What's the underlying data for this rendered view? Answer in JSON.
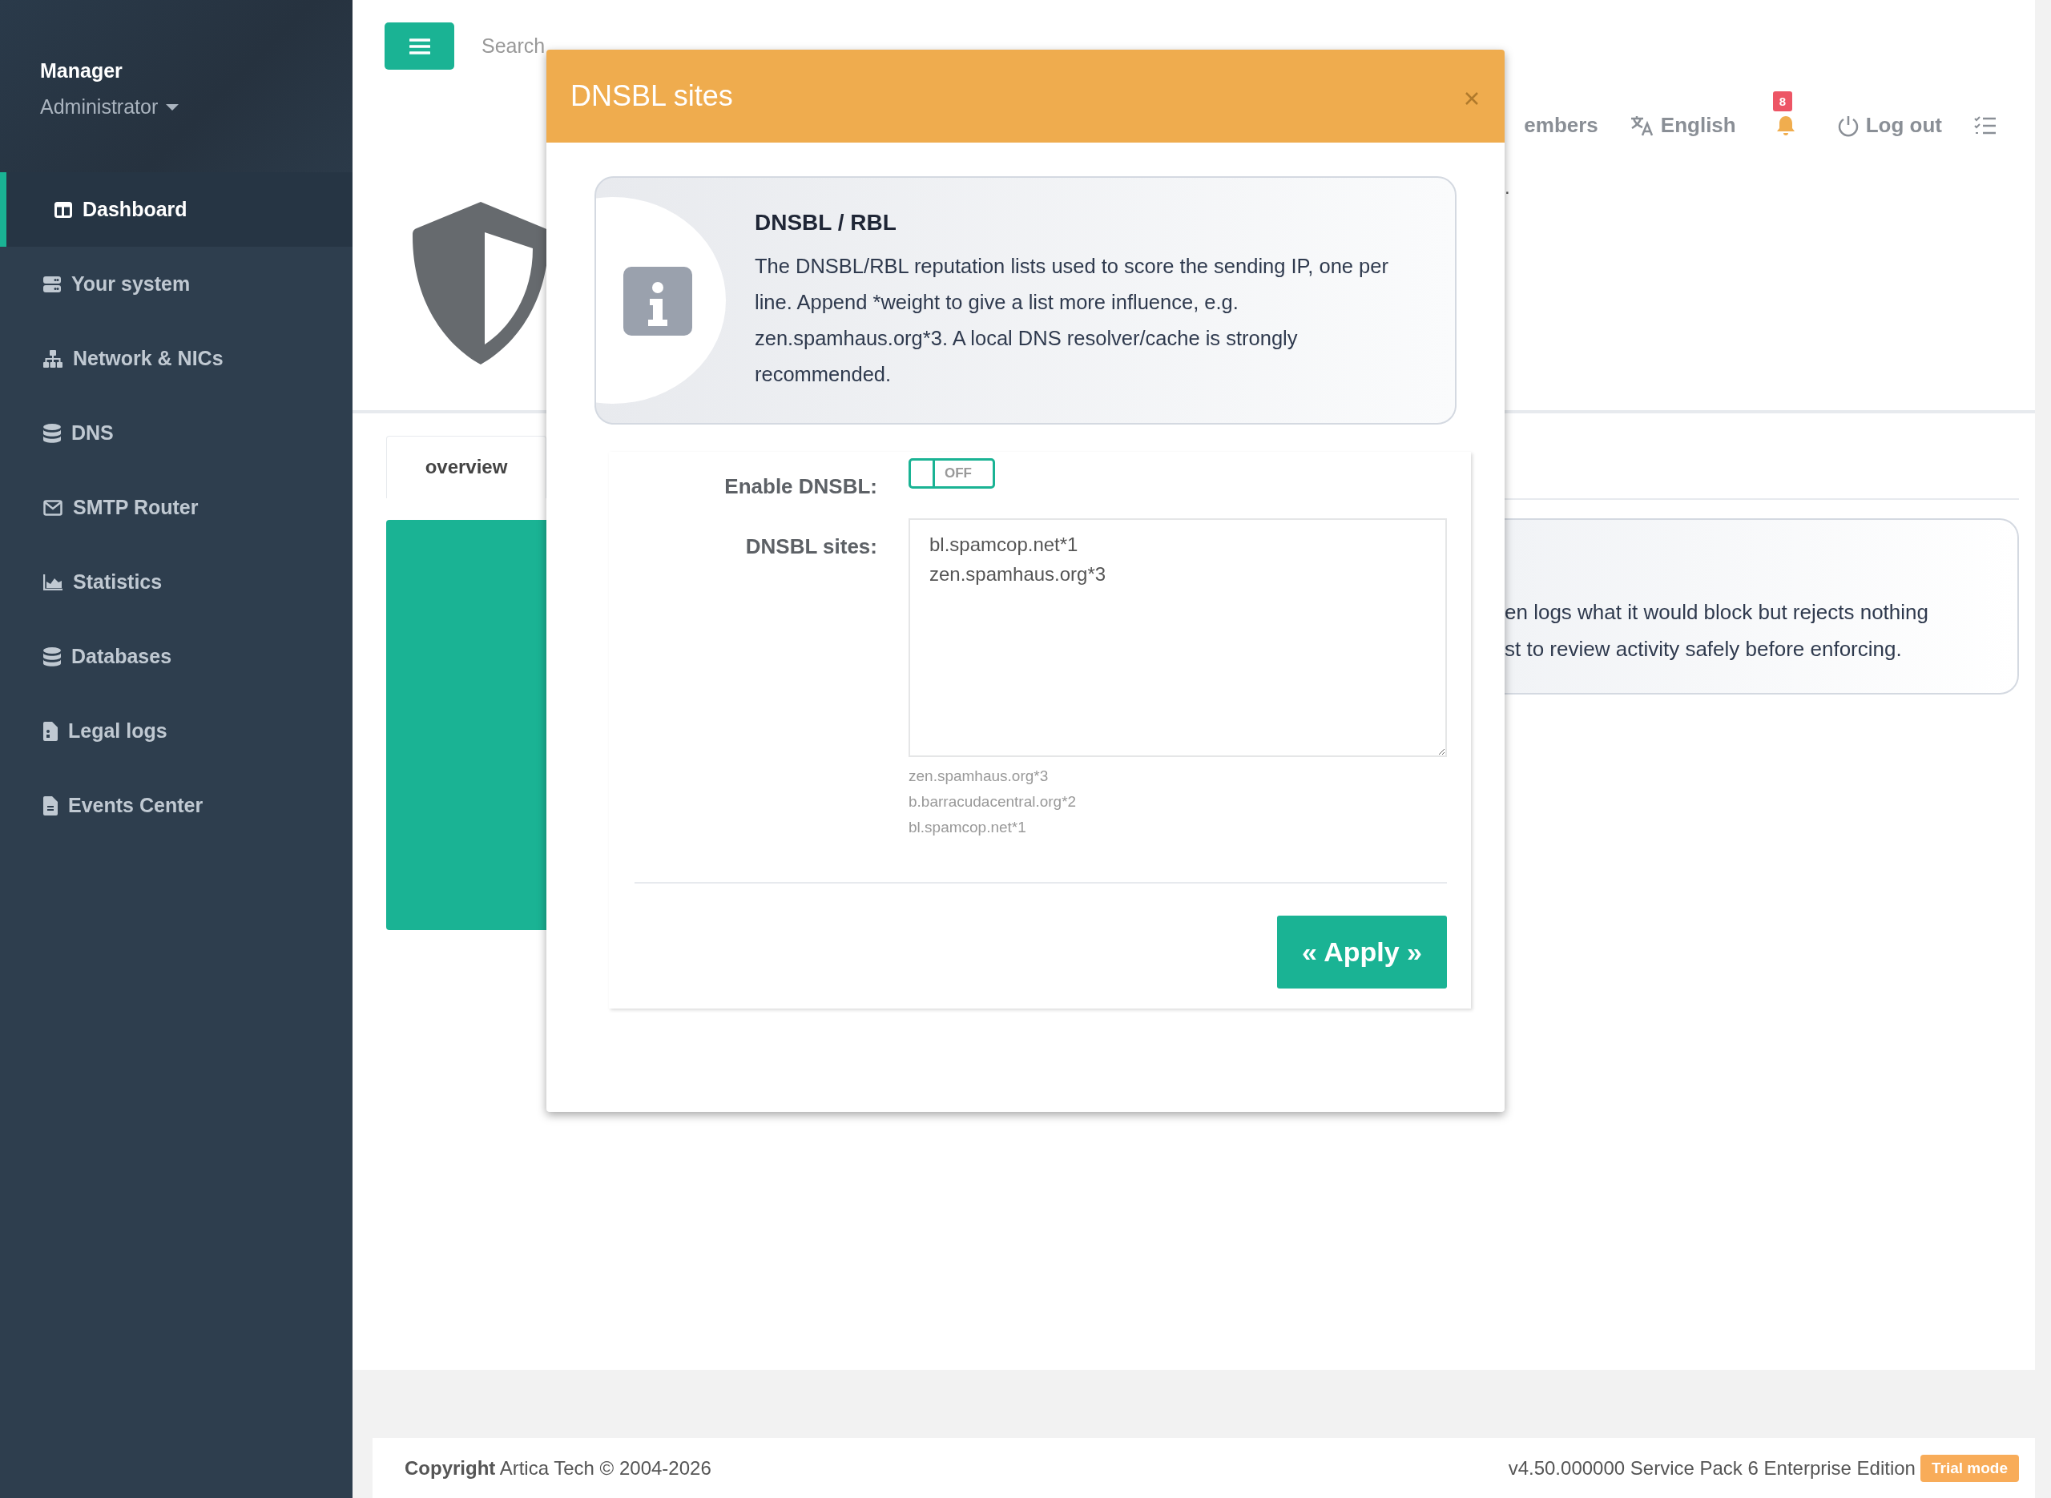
{
  "sidebar": {
    "user": "Manager",
    "role": "Administrator",
    "items": [
      {
        "label": "Dashboard",
        "selected": true
      },
      {
        "label": "Your system",
        "selected": false
      },
      {
        "label": "Network & NICs",
        "selected": false
      },
      {
        "label": "DNS",
        "selected": false
      },
      {
        "label": "SMTP Router",
        "selected": false
      },
      {
        "label": "Statistics",
        "selected": false
      },
      {
        "label": "Databases",
        "selected": false
      },
      {
        "label": "Legal logs",
        "selected": false
      },
      {
        "label": "Events Center",
        "selected": false
      }
    ]
  },
  "topbar": {
    "search": {
      "placeholder": "Search"
    },
    "nav": [
      {
        "kind": "link",
        "label": "embers"
      },
      {
        "kind": "language",
        "label": "English"
      },
      {
        "kind": "notifications",
        "badge": "8"
      },
      {
        "kind": "logout",
        "label": "Log out"
      },
      {
        "kind": "tasks"
      }
    ]
  },
  "page": {
    "header_fragment": ".",
    "tabs": [
      {
        "label": "overview",
        "selected": true
      }
    ],
    "card_fragment_lines": [
      "en logs what it would block but rejects nothing",
      "st to review activity safely before enforcing."
    ]
  },
  "modal": {
    "title": "DNSBL sites",
    "info": {
      "title": "DNSBL / RBL",
      "text": "The DNSBL/RBL reputation lists used to score the sending IP, one per line. Append *weight to give a list more influence, e.g. zen.spamhaus.org*3. A local DNS resolver/cache is strongly recommended."
    },
    "fields": [
      {
        "kind": "toggle",
        "label": "Enable DNSBL:",
        "on": false,
        "state_text": "OFF"
      },
      {
        "kind": "textarea",
        "label": "DNSBL sites:",
        "value": "bl.spamcop.net*1\nzen.spamhaus.org*3",
        "help": [
          "zen.spamhaus.org*3",
          "b.barracudacentral.org*2",
          "bl.spamcop.net*1"
        ]
      }
    ],
    "apply_button": "« Apply »"
  },
  "footer": {
    "copyright": "**Copyright** Artica Tech © 2004-2026",
    "version": "v4.50.000000 Service Pack 6 Enterprise Edition",
    "badge": "Trial mode"
  }
}
